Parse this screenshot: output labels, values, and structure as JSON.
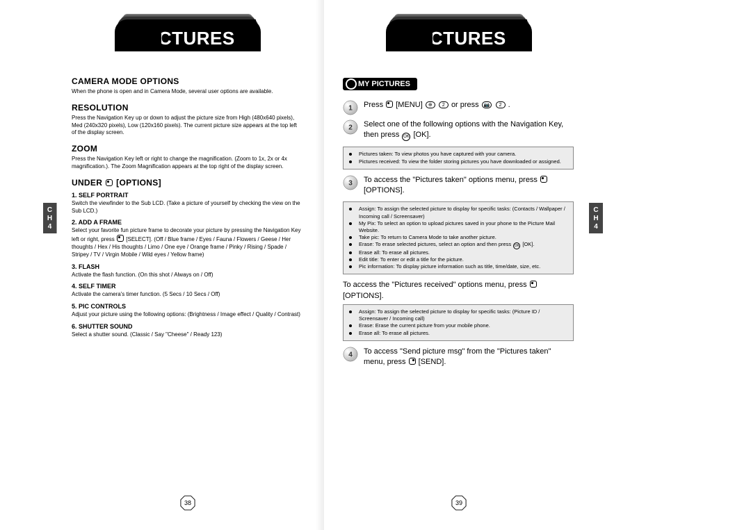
{
  "chapter_tab": "CH4",
  "left": {
    "header": "PICTURES",
    "title1": "CAMERA MODE OPTIONS",
    "intro": "When the phone is open and in Camera Mode, several user options are available.",
    "resolution_h": "RESOLUTION",
    "resolution_body": "Press the Navigation Key up or down to adjust the picture size from High (480x640 pixels), Med (240x320 pixels), Low (120x160 pixels). The current picture size appears at the top left of the display screen.",
    "zoom_h": "ZOOM",
    "zoom_body": "Press the Navigation Key left or right to change the magnification. (Zoom to 1x, 2x or 4x magnification.). The Zoom Magnification appears at the top right of the display screen.",
    "under_h_pre": "UNDER",
    "under_h_post": "[OPTIONS]",
    "opts": {
      "o1h": "1. SELF PORTRAIT",
      "o1b": "Switch the viewfinder to the Sub LCD. (Take a picture of yourself by checking the view on the Sub LCD.)",
      "o2h": "2. ADD A FRAME",
      "o2b": "Select your favorite fun picture frame to decorate your picture by pressing the Navigation Key left or right, press",
      "o2b2": "[SELECT]. (Off / Blue frame / Eyes / Fauna / Flowers / Geese / Her thoughts / Hex / His thoughts / Limo / One eye / Orange frame / Pinky / Rising / Spade / Stripey / TV / Virgin Mobile / Wild eyes / Yellow frame)",
      "o3h": "3. FLASH",
      "o3b": "Activate the flash function. (On this shot / Always on / Off)",
      "o4h": "4. SELF TIMER",
      "o4b": "Activate the camera's timer function. (5 Secs / 10 Secs / Off)",
      "o5h": "5. PIC CONTROLS",
      "o5b": "Adjust your picture using the following options: (Brightness / Image effect / Quality / Contrast)",
      "o6h": "6. SHUTTER SOUND",
      "o6b": "Select a shutter sound. (Classic / Say \"Cheese\" / Ready 123)"
    },
    "pagenum": "38"
  },
  "right": {
    "header": "PICTURES",
    "section": "MY PICTURES",
    "s1a": "Press",
    "s1b": "[MENU]",
    "s1c": "or press",
    "s1d": ".",
    "s2": "Select one of the following options with the Navigation Key, then press",
    "s2b": "[OK].",
    "box1a": "Pictures taken: To view photos you have captured with your camera.",
    "box1b": "Pictures received: To view the folder storing pictures you have downloaded or assigned.",
    "s3a": "To access the \"Pictures taken\" options menu, press",
    "s3b": "[OPTIONS].",
    "box2a": "Assign: To assign the selected picture to display for specific tasks: (Contacts / Wallpaper / Incoming call / Screensaver)",
    "box2b": "My Pix: To select an option to upload pictures saved in your phone to the Picture Mail Website.",
    "box2c": "Take pic: To return to Camera Mode to take another picture.",
    "box2d": "Erase: To erase selected pictures, select an option and then press",
    "box2d2": "[OK].",
    "box2e": "Erase all: To erase all pictures.",
    "box2f": "Edit title: To enter or edit a title for the picture.",
    "box2g": "Pic information: To display picture information such as title, time/date, size, etc.",
    "s_rec_a": "To access the \"Pictures received\" options menu, press",
    "s_rec_b": "[OPTIONS].",
    "box3a": "Assign: To assign the selected picture to display for specific tasks: (Picture ID / Screensaver / Incoming call)",
    "box3b": "Erase: Erase the current picture from your mobile phone.",
    "box3c": "Erase all: To erase all pictures.",
    "s4a": "To access \"Send picture msg\" from the \"Pictures taken\" menu, press",
    "s4b": "[SEND].",
    "pagenum": "39"
  }
}
